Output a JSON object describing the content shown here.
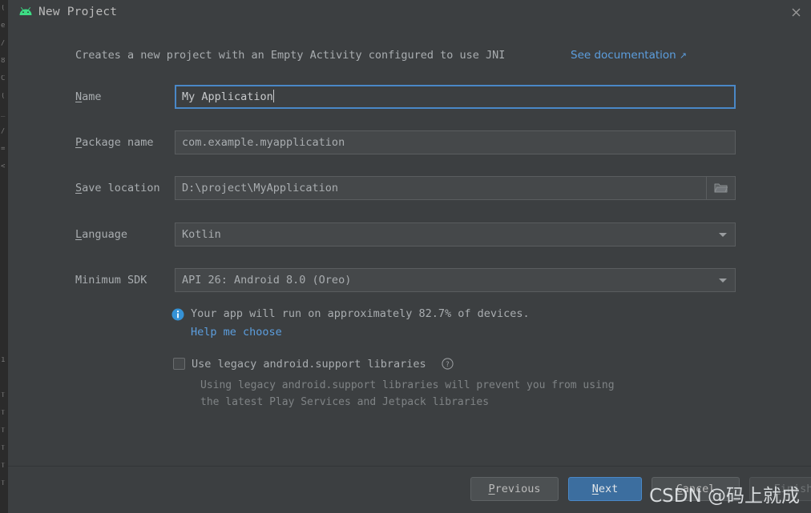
{
  "window": {
    "title": "New Project",
    "app_icon": "android-robot-icon",
    "close_icon": "close-icon"
  },
  "header": {
    "description": "Creates a new project with an Empty Activity configured to use JNI",
    "doc_link_label": "See documentation",
    "doc_link_arrow": "↗"
  },
  "form": {
    "fields": [
      {
        "id": "name",
        "label_mnemonic": "N",
        "label_rest": "ame",
        "value": "My Application",
        "type": "text",
        "focused": true
      },
      {
        "id": "package-name",
        "label_mnemonic": "P",
        "label_rest": "ackage name",
        "value": "com.example.myapplication",
        "type": "text",
        "focused": false
      },
      {
        "id": "save-location",
        "label_mnemonic": "S",
        "label_rest": "ave location",
        "value": "D:\\project\\MyApplication",
        "type": "text-with-browse",
        "browse_icon": "folder-icon",
        "focused": false
      },
      {
        "id": "language",
        "label_mnemonic": "L",
        "label_rest": "anguage",
        "value": "Kotlin",
        "type": "combo",
        "arrow_icon": "chevron-down-icon"
      },
      {
        "id": "minimum-sdk",
        "label_mnemonic": "",
        "label_rest": "Minimum SDK",
        "value": "API 26: Android 8.0 (Oreo)",
        "type": "combo",
        "arrow_icon": "chevron-down-icon"
      }
    ]
  },
  "info": {
    "icon": "info-circle-icon",
    "message": "Your app will run on approximately 82.7% of devices.",
    "percent": "82.7%",
    "help_link_label": "Help me choose"
  },
  "legacy": {
    "checkbox_checked": false,
    "label": "Use legacy android.support libraries",
    "help_icon": "question-circle-icon",
    "note_line_1": "Using legacy android.support libraries will prevent you from using",
    "note_line_2": "the latest Play Services and Jetpack libraries"
  },
  "footer": {
    "buttons": [
      {
        "id": "previous",
        "mnemonic": "P",
        "rest": "revious",
        "style": "default",
        "enabled": true
      },
      {
        "id": "next",
        "mnemonic": "N",
        "rest": "ext",
        "style": "primary",
        "enabled": true
      },
      {
        "id": "cancel",
        "mnemonic": "C",
        "rest": "ancel",
        "style": "default",
        "enabled": true
      },
      {
        "id": "finish",
        "mnemonic": "F",
        "rest": "inish",
        "style": "disabled",
        "enabled": false
      }
    ]
  },
  "watermark": {
    "text": "CSDN @码上就成"
  },
  "colors": {
    "dialog_bg": "#3c3f41",
    "field_bg": "#45484a",
    "focus_border": "#4a88c7",
    "link": "#5c9ede",
    "text": "#a9adb0",
    "primary_button": "#3c6e9f",
    "android_green": "#3ddc84"
  },
  "backdrop_lines": [
    "(",
    "e",
    "/",
    "8",
    "C",
    "(",
    "_",
    "/",
    "=",
    "<",
    "",
    "",
    "",
    "",
    "",
    "",
    "",
    "",
    "",
    "",
    "1",
    "",
    "T",
    "T",
    "T",
    "T",
    "T",
    "T"
  ]
}
